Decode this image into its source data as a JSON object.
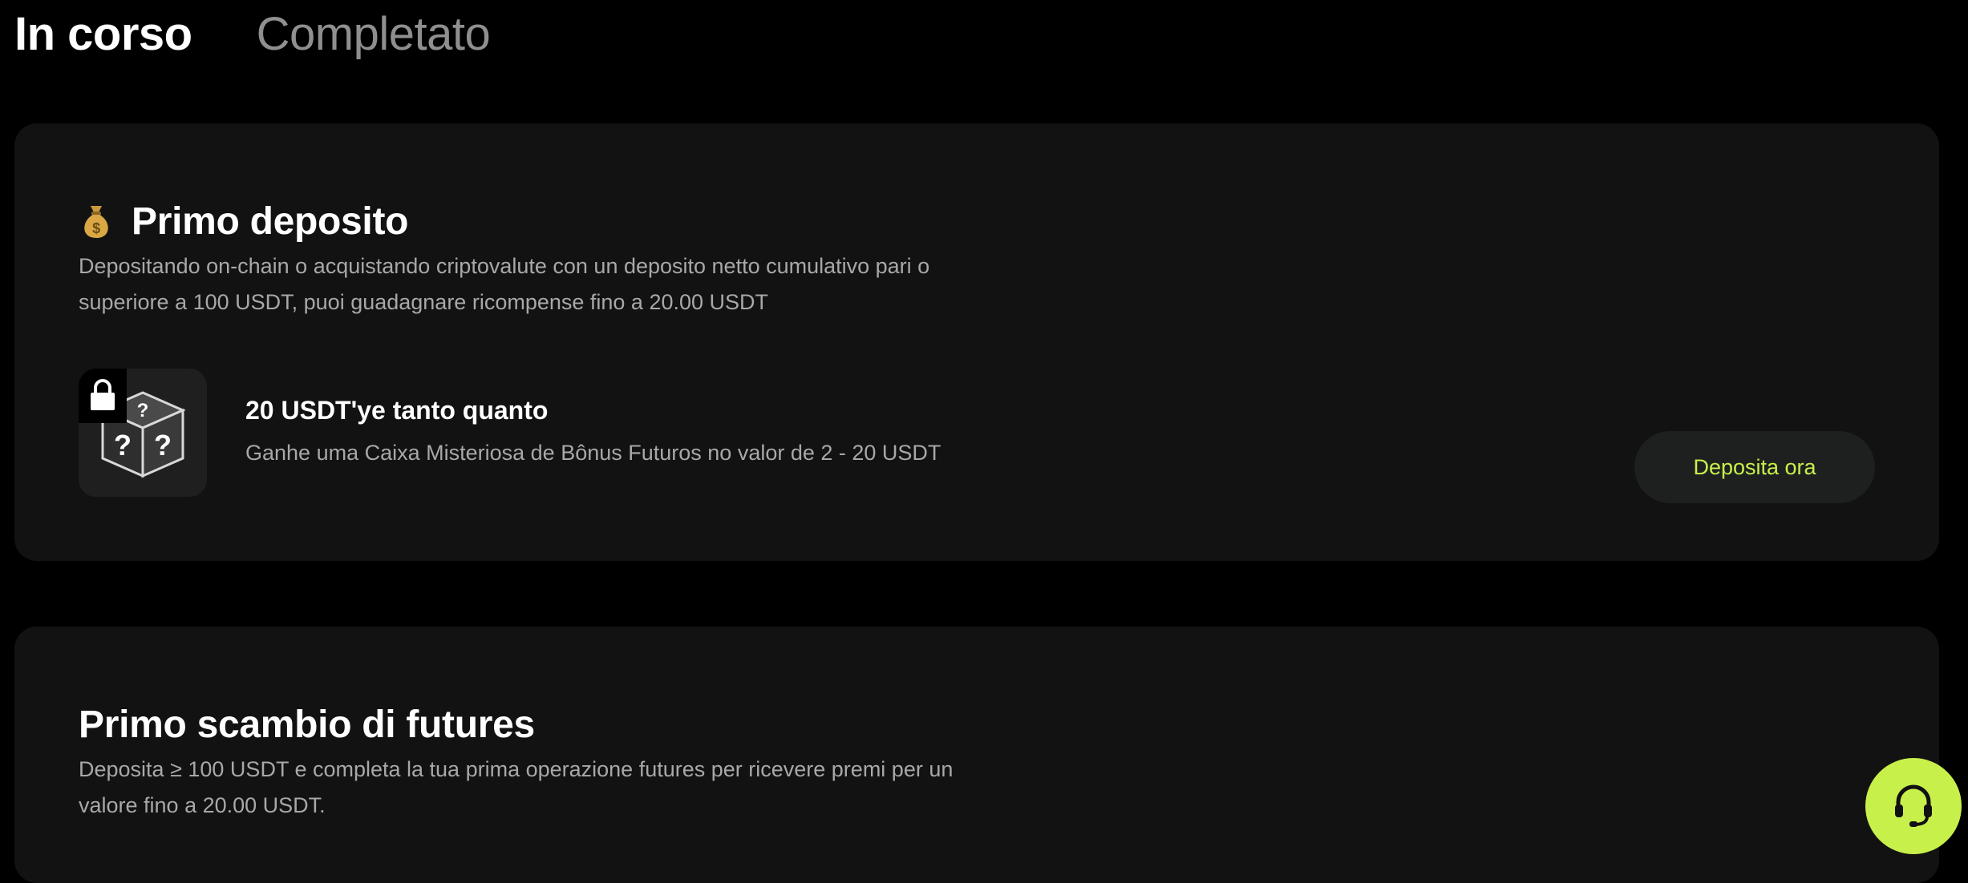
{
  "tabs": [
    {
      "label": "In corso",
      "active": true
    },
    {
      "label": "Completato",
      "active": false
    }
  ],
  "cards": [
    {
      "icon": "money-bag-icon",
      "title": "Primo deposito",
      "description": "Depositando on-chain o acquistando criptovalute con un deposito netto cumulativo pari o superiore a 100 USDT, puoi guadagnare ricompense fino a 20.00 USDT",
      "reward": {
        "image": "mystery-box-icon",
        "locked": true,
        "title": "20 USDT'ye tanto quanto",
        "subtitle": "Ganhe uma Caixa Misteriosa de Bônus Futuros no valor de 2 - 20 USDT",
        "button_label": "Deposita ora"
      }
    },
    {
      "title": "Primo scambio di futures",
      "description": "Deposita ≥ 100 USDT e completa la tua prima operazione futures per ricevere premi per un valore fino a 20.00 USDT."
    }
  ],
  "support": {
    "icon": "headset-icon"
  },
  "colors": {
    "background": "#000000",
    "card": "#121212",
    "accent": "#c8f04a",
    "muted_text": "#a8a8a8",
    "inactive_tab": "#8f8f8f"
  }
}
